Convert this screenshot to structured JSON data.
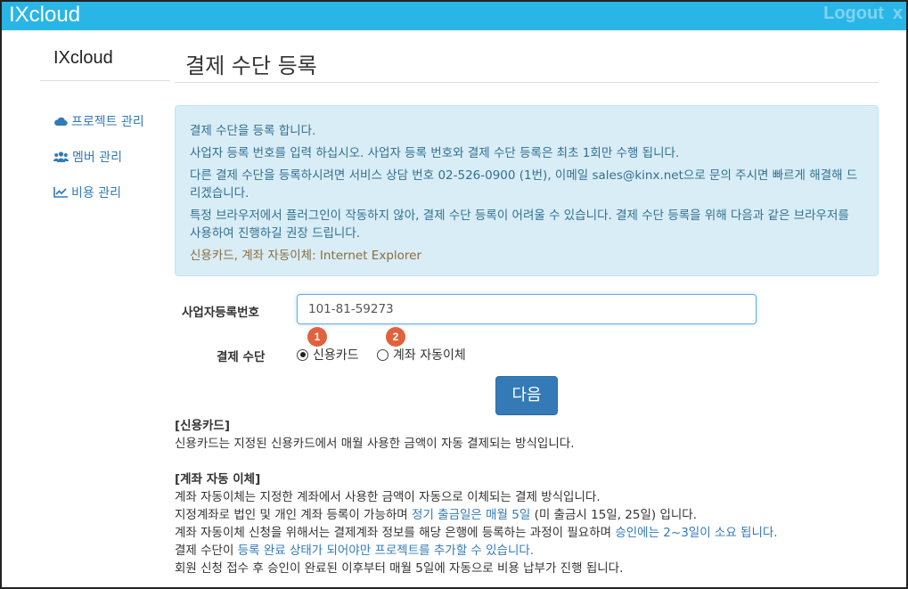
{
  "app": {
    "brand": "IXcloud",
    "logout_label": "Logout",
    "logout_close": "x"
  },
  "sidebar": {
    "title": "IXcloud",
    "items": [
      {
        "label": "프로젝트 관리",
        "icon": "cloud-icon"
      },
      {
        "label": "멤버 관리",
        "icon": "users-icon"
      },
      {
        "label": "비용 관리",
        "icon": "chart-icon"
      }
    ]
  },
  "page": {
    "title": "결제 수단 등록"
  },
  "notice": {
    "lines": [
      "결제 수단을 등록 합니다.",
      "사업자 등록 번호를 입력 하십시오. 사업자 등록 번호와 결제 수단 등록은 최초 1회만 수행 됩니다.",
      "다른 결제 수단을 등록하시려면 서비스 상담 번호 02-526-0900 (1번), 이메일 sales@kinx.net으로 문의 주시면 빠르게 해결해 드리겠습니다.",
      "특정 브라우저에서 플러그인이 작동하지 않아, 결제 수단 등록이 어려울 수 있습니다. 결제 수단 등록을 위해 다음과 같은 브라우저를 사용하여 진행하길 권장 드립니다.",
      "신용카드, 계좌 자동이체: Internet Explorer"
    ]
  },
  "form": {
    "biz_label": "사업자등록번호",
    "biz_value": "101-81-59273",
    "method_label": "결제 수단",
    "options": [
      {
        "label": "신용카드",
        "badge": "1",
        "checked": true
      },
      {
        "label": "계좌 자동이체",
        "badge": "2",
        "checked": false
      }
    ],
    "next_label": "다음"
  },
  "credit_info": {
    "heading": "[신용카드]",
    "text": "신용카드는 지정된 신용카드에서 매월 사용한 금액이 자동 결제되는 방식입니다."
  },
  "bank_info": {
    "heading": "[계좌 자동 이체]",
    "line1": "계좌 자동이체는 지정한 계좌에서 사용한 금액이 자동으로 이체되는 결제 방식입니다.",
    "line2_a": "지정계좌로 법인 및 개인 계좌 등록이 가능하며 ",
    "line2_b": "정기 출금일은 매월 5일",
    "line2_c": " (미 출금시 15일, 25일) 입니다.",
    "line3_a": "계좌 자동이체 신청을 위해서는 결제계좌 정보를 해당 은행에 등록하는 과정이 필요하며 ",
    "line3_b": "승인에는 2~3일이 소요 됩니다.",
    "line4_a": "결제 수단이 ",
    "line4_b": "등록 완료 상태가 되어야만 프로젝트를 추가할 수 있습니다.",
    "line5": "회원 신청 접수 후 승인이 완료된 이후부터 매월 5일에 자동으로 비용 납부가 진행 됩니다."
  }
}
